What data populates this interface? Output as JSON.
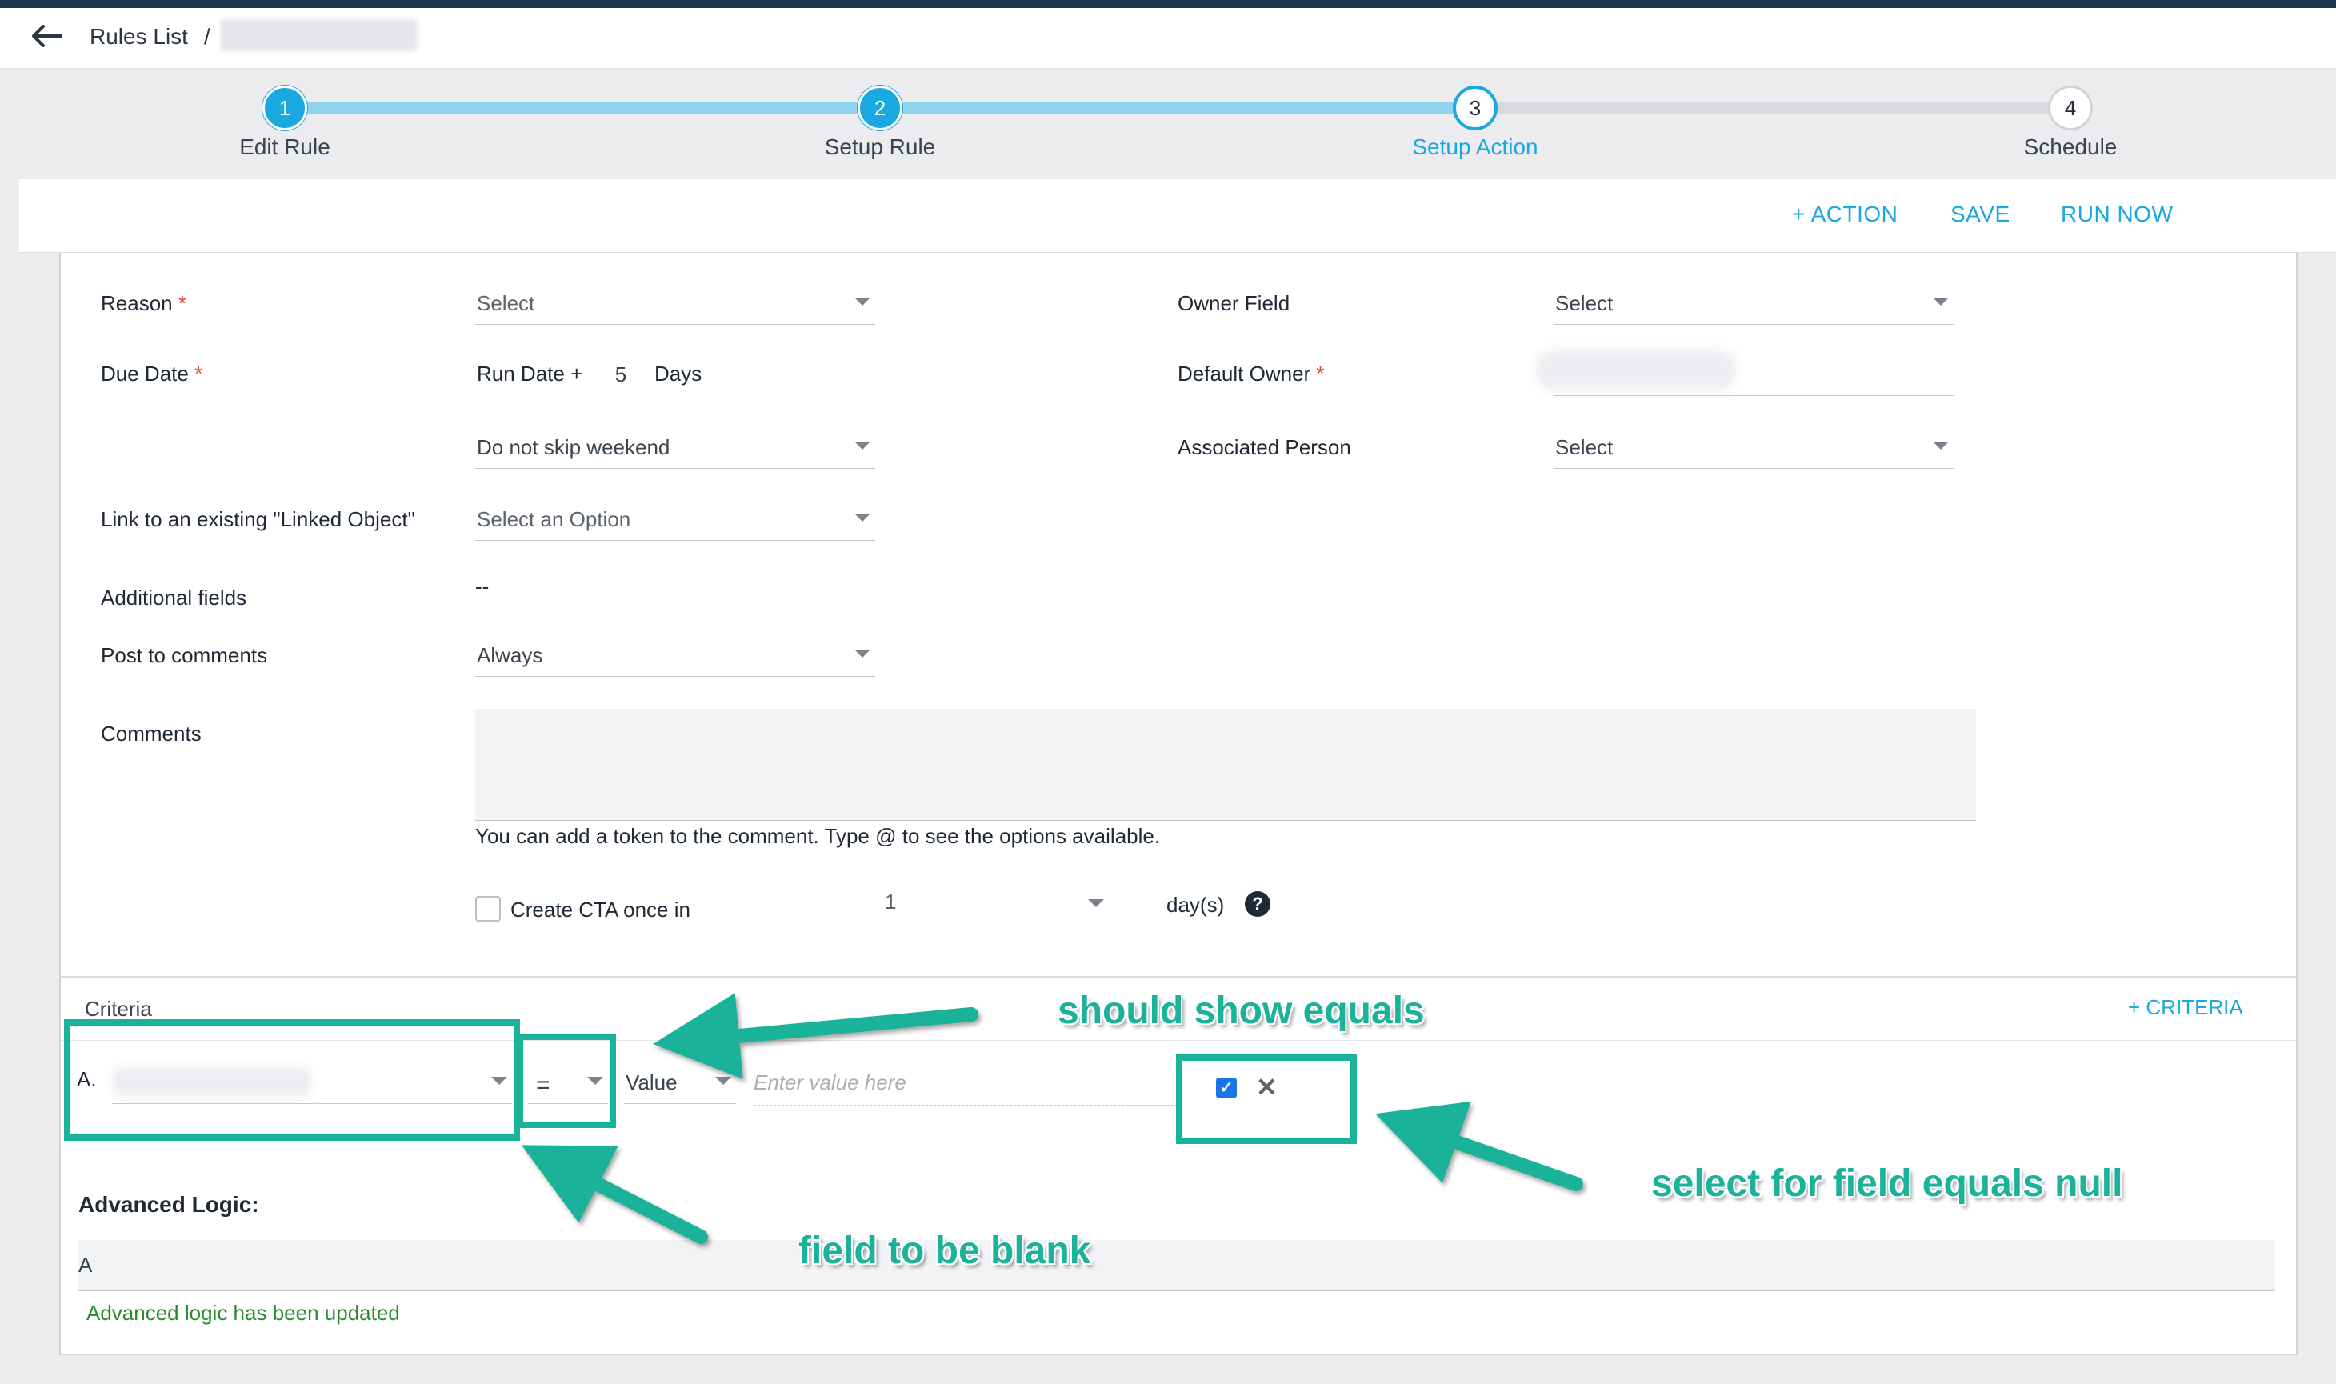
{
  "header": {
    "breadcrumb_root": "Rules List",
    "breadcrumb_separator": "/"
  },
  "stepper": {
    "steps": [
      {
        "number": "1",
        "label": "Edit Rule",
        "state": "done"
      },
      {
        "number": "2",
        "label": "Setup Rule",
        "state": "done"
      },
      {
        "number": "3",
        "label": "Setup Action",
        "state": "current"
      },
      {
        "number": "4",
        "label": "Schedule",
        "state": "todo"
      }
    ],
    "accent_color": "#1aa8e0"
  },
  "toolbar": {
    "add_action": "+ ACTION",
    "save": "SAVE",
    "run_now": "RUN NOW"
  },
  "form": {
    "reason": {
      "label": "Reason",
      "required": "*",
      "value": "Select"
    },
    "due_date": {
      "label": "Due Date",
      "required": "*",
      "prefix": "Run Date +",
      "days": "5",
      "suffix": "Days"
    },
    "skip_weekend": {
      "value": "Do not skip weekend"
    },
    "linked_object": {
      "label": "Link to an existing \"Linked Object\"",
      "value": "Select an Option"
    },
    "additional_fields": {
      "label": "Additional fields",
      "value": "--"
    },
    "post_to_comments": {
      "label": "Post to comments",
      "value": "Always"
    },
    "comments": {
      "label": "Comments",
      "hint": "You can add a token to the comment. Type @ to see the options available."
    },
    "create_cta": {
      "label": "Create CTA once in",
      "value": "1",
      "unit": "day(s)",
      "help_icon": "?"
    },
    "owner_field": {
      "label": "Owner Field",
      "value": "Select"
    },
    "default_owner": {
      "label": "Default Owner",
      "required": "*"
    },
    "associated_person": {
      "label": "Associated Person",
      "value": "Select"
    }
  },
  "criteria": {
    "title": "Criteria",
    "add_button": "+ CRITERIA",
    "row": {
      "letter": "A.",
      "operator": "=",
      "value_type": "Value",
      "value_placeholder": "Enter value here",
      "null_checked": "✓",
      "remove_icon": "✕"
    },
    "advanced_logic_title": "Advanced Logic:",
    "advanced_logic_value": "A",
    "advanced_logic_message": "Advanced logic has been updated"
  },
  "annotations": {
    "should_show_equals": "should show equals",
    "select_for_null": "select for field equals null",
    "field_blank": "field to be blank",
    "color": "#1ab39a"
  }
}
